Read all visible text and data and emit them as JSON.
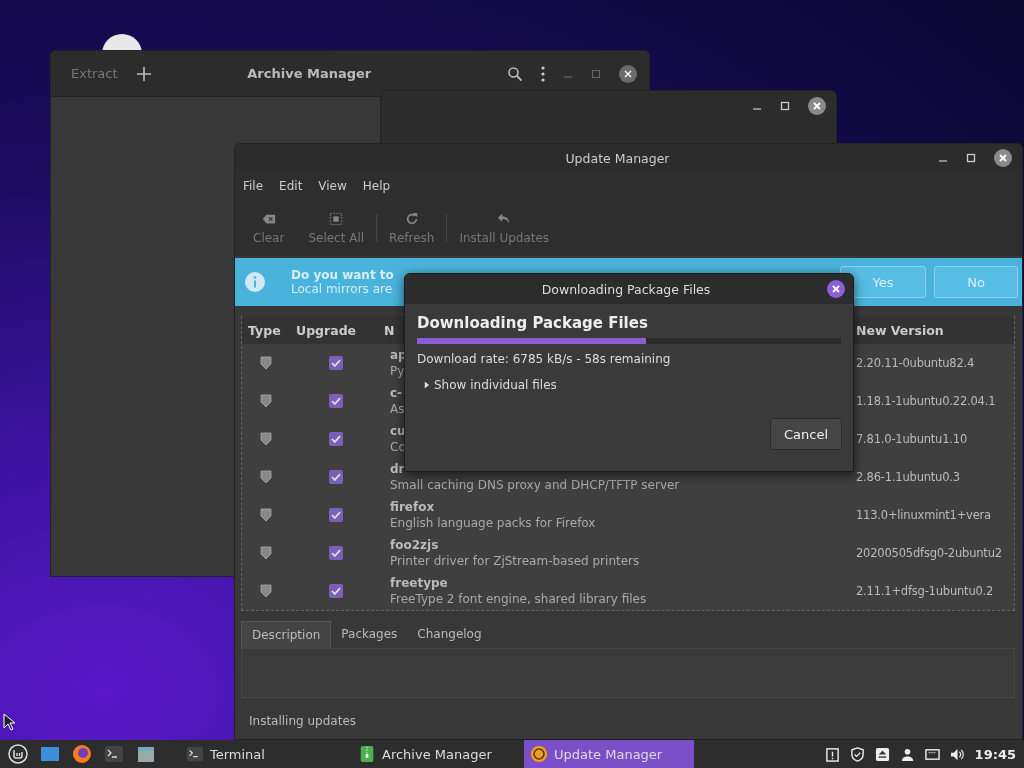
{
  "archive_window": {
    "title": "Archive Manager",
    "extract": {
      "label": "Extract",
      "disabled": true
    }
  },
  "update_window": {
    "title": "Update Manager",
    "menu": [
      "File",
      "Edit",
      "View",
      "Help"
    ],
    "toolbar": [
      {
        "kind": "clear",
        "label": "Clear",
        "disabled": true
      },
      {
        "kind": "select",
        "label": "Select All",
        "disabled": true
      },
      {
        "kind": "refresh",
        "label": "Refresh",
        "disabled": true
      },
      {
        "kind": "install",
        "label": "Install Updates",
        "disabled": true
      }
    ],
    "infobar": {
      "title": "Do you want to",
      "message": "Local mirrors are",
      "buttons": [
        "Yes",
        "No"
      ]
    },
    "table": {
      "columns": [
        "Type",
        "Upgrade",
        "N",
        "New Version"
      ],
      "rows": [
        {
          "name": "ap",
          "description": "Py",
          "new_version": "2.20.11-0ubuntu82.4",
          "upgrade": true
        },
        {
          "name": "c-",
          "description": "As",
          "new_version": "1.18.1-1ubuntu0.22.04.1",
          "upgrade": true
        },
        {
          "name": "cu",
          "description": "Co",
          "new_version": "7.81.0-1ubuntu1.10",
          "upgrade": true
        },
        {
          "name": "dr",
          "description": "Small caching DNS proxy and DHCP/TFTP server",
          "new_version": "2.86-1.1ubuntu0.3",
          "upgrade": true
        },
        {
          "name": "firefox",
          "description": "English language packs for Firefox",
          "new_version": "113.0+linuxmint1+vera",
          "upgrade": true
        },
        {
          "name": "foo2zjs",
          "description": "Printer driver for ZjStream-based printers",
          "new_version": "20200505dfsg0-2ubuntu2",
          "upgrade": true
        },
        {
          "name": "freetype",
          "description": "FreeType 2 font engine, shared library files",
          "new_version": "2.11.1+dfsg-1ubuntu0.2",
          "upgrade": true
        }
      ]
    },
    "tabs": [
      {
        "label": "Description",
        "selected": true
      },
      {
        "label": "Packages",
        "selected": false
      },
      {
        "label": "Changelog",
        "selected": false
      }
    ],
    "status": "Installing updates"
  },
  "dialog": {
    "title": "Downloading Package Files",
    "heading": "Downloading Package Files",
    "level": 0.54,
    "rate": "Download rate: 6785 kB/s - 58s remaining",
    "expander": {
      "label": "Show individual files",
      "expanded": false
    },
    "button": "Cancel"
  },
  "taskbar": {
    "tasks": [
      {
        "kind": "terminal",
        "label": "Terminal",
        "selected": false
      },
      {
        "kind": "archive",
        "label": "Archive Manager",
        "selected": false
      },
      {
        "kind": "update",
        "label": "Update Manager",
        "selected": true
      }
    ],
    "clock": "19:45"
  }
}
